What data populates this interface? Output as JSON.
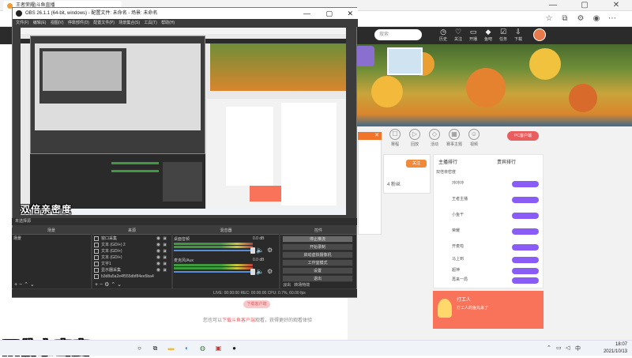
{
  "browser": {
    "tab_title": "王者荣耀|斗鱼直播",
    "window_controls": [
      "—",
      "▢",
      "✕"
    ],
    "search_placeholder": "搜索",
    "nav_items": [
      "历史",
      "关注",
      "开播",
      "鱼吧",
      "任务",
      "下载",
      "更多"
    ]
  },
  "page": {
    "features": [
      "赛程",
      "回放",
      "活动",
      "赛事主题",
      "视频"
    ],
    "pc_button": "PC客户端",
    "panel_tabs": [
      "主播排行",
      "贵宾排行"
    ],
    "rank_rows": [
      "双倍亲密度",
      "冲冲冲",
      "王者主播",
      "小鱼干",
      "荣耀",
      "开麦啦",
      "马上到",
      "超神",
      "再来一局",
      "冲鸭"
    ],
    "promo_title": "打工人",
    "promo_text": "打工人的鱼丸来了",
    "bottom_text_prefix": "您也可以",
    "bottom_text_highlight": "下载斗鱼客户端",
    "bottom_text_suffix": "观看，获得更好的观看体验",
    "seg_button": "下载客户端",
    "left_btn": "关注",
    "follow_count": "4",
    "fans_label": "粉丝"
  },
  "obs": {
    "title": "OBS 26.1.1 (64-bit, windows) - 配置文件: 未命名 - 场景: 未命名",
    "menu": [
      "文件(F)",
      "编辑(E)",
      "视图(V)",
      "停靠部件(D)",
      "配置文件(P)",
      "场景集合(S)",
      "工具(T)",
      "帮助(H)"
    ],
    "preview_overlay": "双倍亲密度",
    "status_left": "未选择源",
    "docks": {
      "scenes": "场景",
      "sources": "来源",
      "mixer": "混音器",
      "transitions": "转场",
      "controls": "控件"
    },
    "scene_item": "场景",
    "sources": [
      "窗口采集",
      "文本 (GDI+) 2",
      "文本 (GDI+)",
      "文本 (GDI+)",
      "文字1",
      "显示器采集",
      "b3d8a5a2e4f555dbf84ee5ba4"
    ],
    "mixer_tracks": [
      {
        "name": "桌面音频",
        "db": "0.0 dB",
        "level": 0.8
      },
      {
        "name": "麦克风/Aux",
        "db": "0.0 dB",
        "level": 0.8
      }
    ],
    "controls": [
      "停止推流",
      "开始录制",
      "启动虚拟摄像机",
      "工作室模式",
      "设置",
      "退出"
    ],
    "controls_footer_left": "淡出",
    "controls_footer_right": "转场特效",
    "bottom_status": "LIVE: 00:00:00   REC: 00:00:00   CPU: 0.7%, 60.00 fps"
  },
  "caption": "双倍亲密度",
  "taskbar": {
    "time": "18:07",
    "date": "2021/10/13",
    "lang": "中"
  },
  "colors": {
    "accent_orange": "#f08a3a",
    "douyu_red": "#e85d5d",
    "obs_bg": "#3c3c3c"
  }
}
